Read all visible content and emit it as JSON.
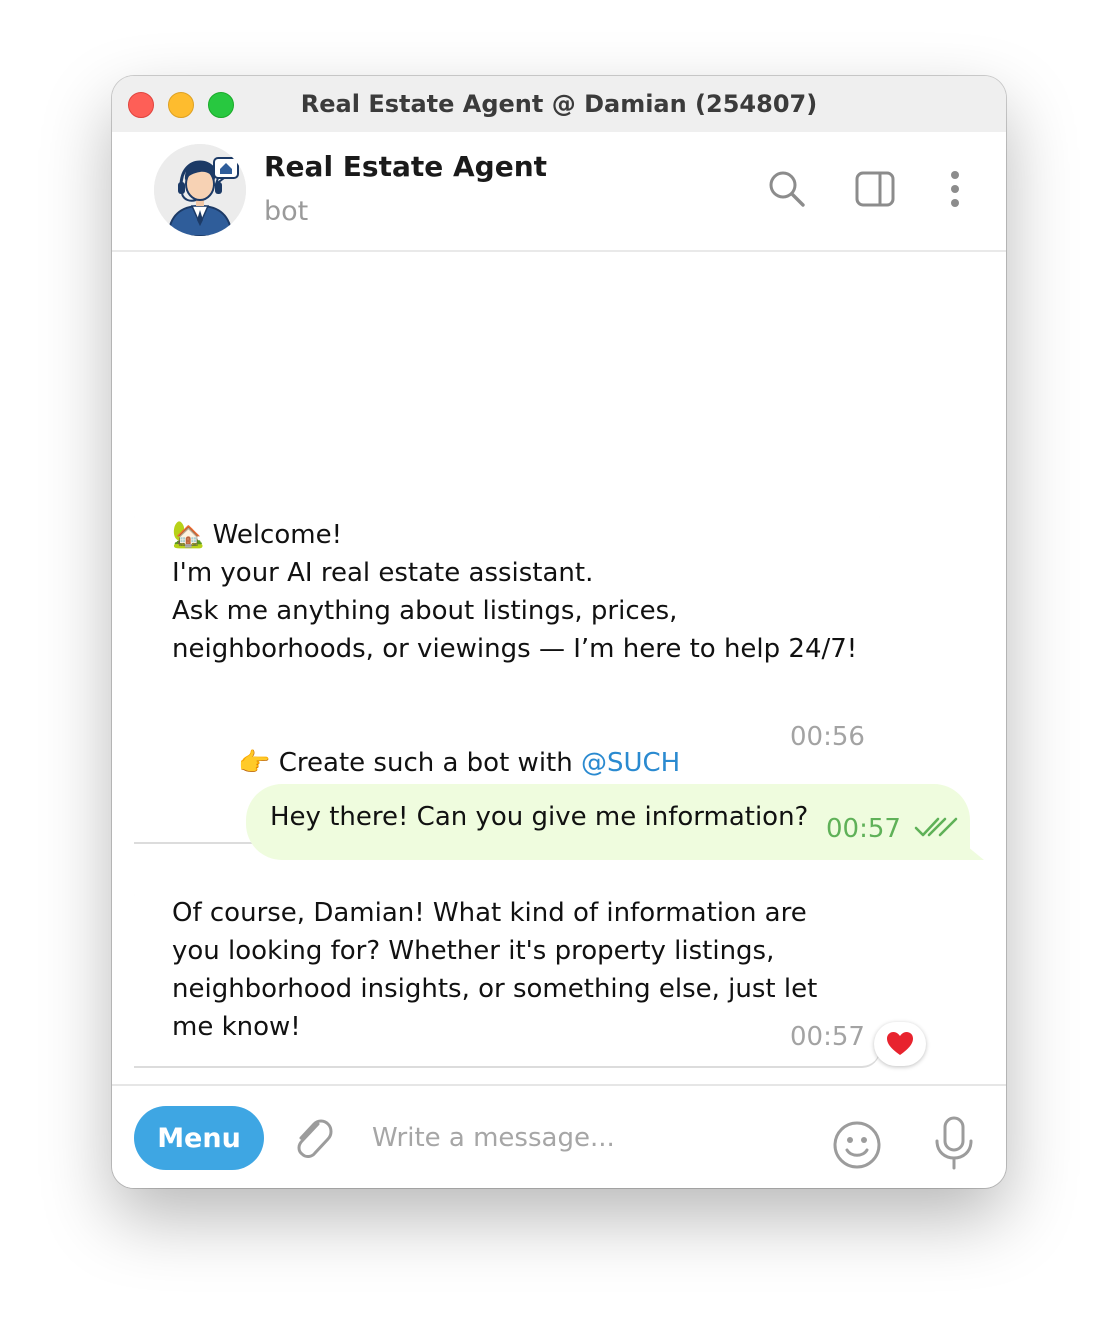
{
  "window": {
    "title": "Real Estate Agent @ Damian (254807)"
  },
  "header": {
    "name": "Real Estate Agent",
    "status": "bot",
    "icons": [
      "search-icon",
      "sidebar-toggle-icon",
      "more-vertical-icon"
    ]
  },
  "messages": {
    "welcome": {
      "line1": "🏡 Welcome!",
      "line2": "I'm your AI real estate assistant.",
      "line3": "Ask me anything about listings, prices,",
      "line4": "neighborhoods, or viewings — I’m here to help 24/7!",
      "cta_emoji": "👉",
      "cta_text": " Create such a bot with ",
      "cta_mention": "@SUCH",
      "time": "00:56"
    },
    "user": {
      "text": "Hey there! Can you give me information?",
      "time": "00:57"
    },
    "reply": {
      "text": "Of course, Damian! What kind of information are\nyou looking for? Whether it's property listings,\nneighborhood insights, or something else, just let\nme know!",
      "time": "00:57",
      "reaction": "❤️"
    }
  },
  "composer": {
    "menu_label": "Menu",
    "placeholder": "Write a message..."
  },
  "colors": {
    "menu_button": "#3ea6e3",
    "outgoing_bubble": "#effcde",
    "outgoing_time": "#5fb158",
    "mention": "#2a8ad0"
  }
}
